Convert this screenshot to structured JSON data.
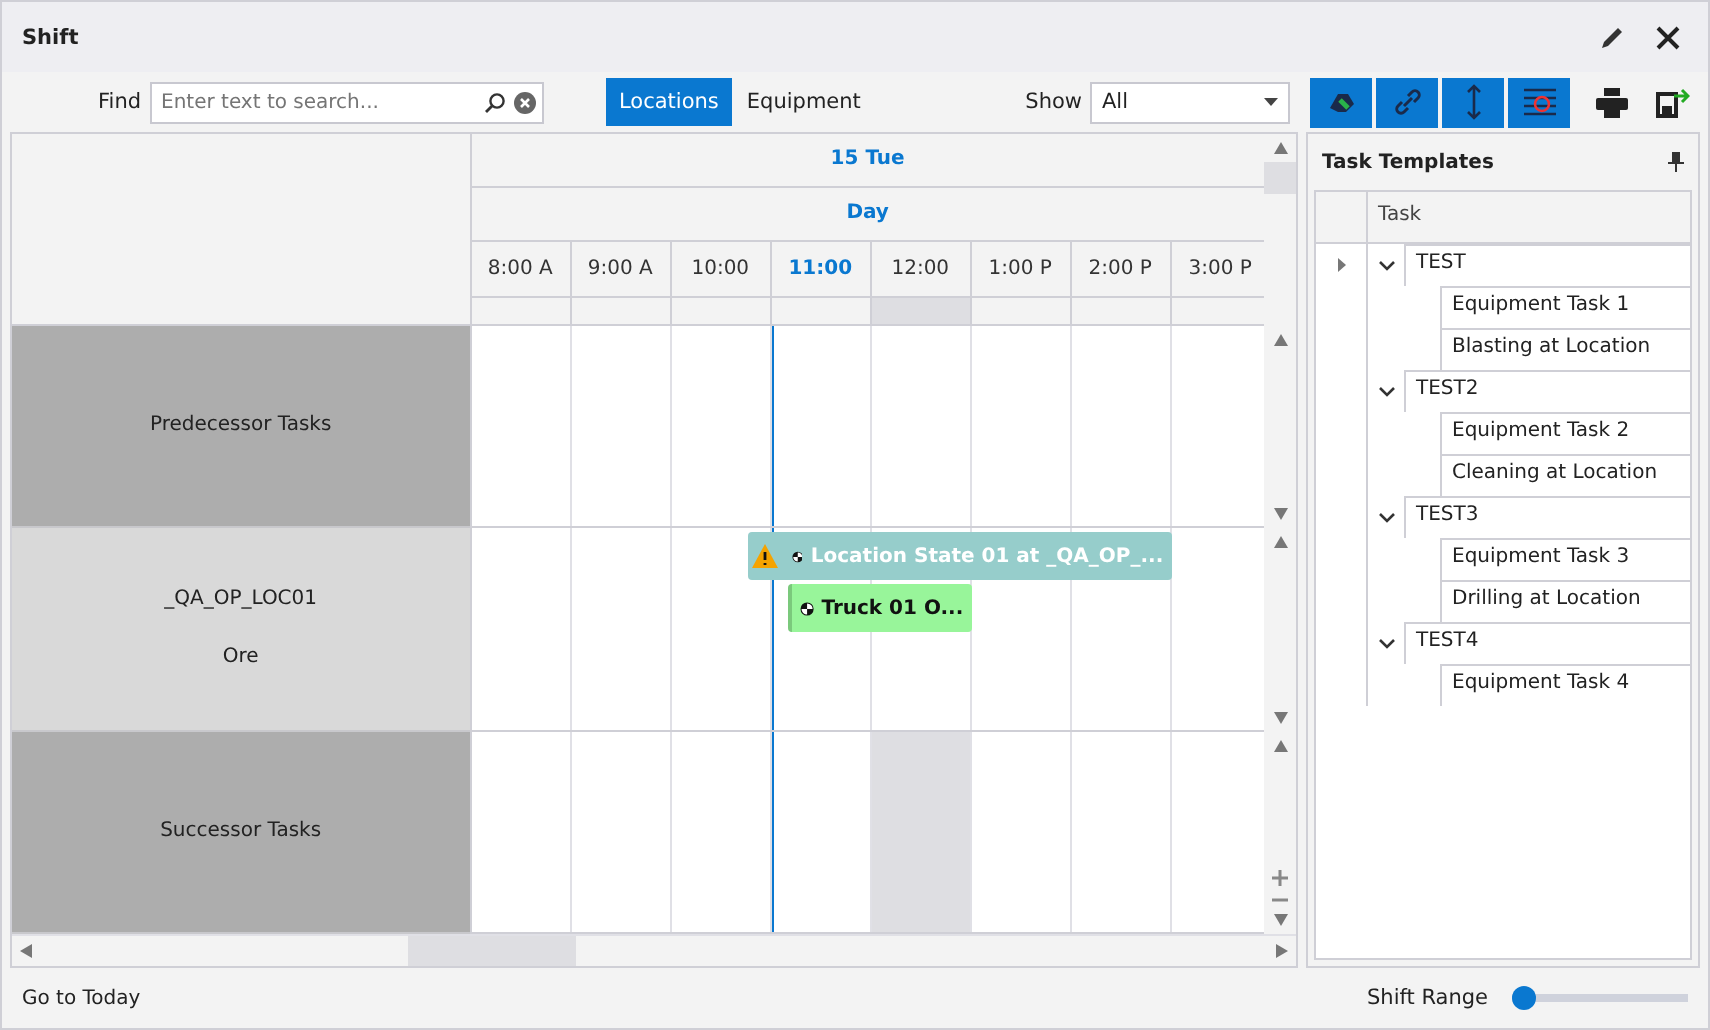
{
  "window": {
    "title": "Shift"
  },
  "find": {
    "label": "Find",
    "placeholder": "Enter text to search..."
  },
  "view_tabs": [
    {
      "label": "Locations",
      "selected": true
    },
    {
      "label": "Equipment",
      "selected": false
    }
  ],
  "show": {
    "label": "Show",
    "value": "All"
  },
  "toggles": [
    {
      "on": true
    },
    {
      "on": true
    },
    {
      "on": true
    },
    {
      "on": true
    }
  ],
  "scheduler": {
    "date": "15 Tue",
    "scale": "Day",
    "hours": [
      {
        "label": "8:00 A",
        "current": false
      },
      {
        "label": "9:00 A",
        "current": false
      },
      {
        "label": "10:00",
        "current": false
      },
      {
        "label": "11:00",
        "current": true
      },
      {
        "label": "12:00",
        "current": false
      },
      {
        "label": "1:00 P",
        "current": false
      },
      {
        "label": "2:00 P",
        "current": false
      },
      {
        "label": "3:00 P",
        "current": false
      }
    ],
    "rows": [
      {
        "kind": "group",
        "label": "Predecessor Tasks"
      },
      {
        "kind": "resource",
        "label": "_QA_OP_LOC01",
        "sublabel": "Ore",
        "events": [
          {
            "kind": "location",
            "text": "Location State 01 at _QA_OP_...",
            "warning": true
          },
          {
            "kind": "equipment",
            "text": "Truck 01 O...",
            "warning": false
          }
        ]
      },
      {
        "kind": "group",
        "label": "Successor Tasks"
      }
    ]
  },
  "task_panel": {
    "title": "Task Templates",
    "column": "Task",
    "tree": [
      {
        "label": "TEST",
        "expanded": true,
        "children": [
          {
            "label": "Equipment Task 1"
          },
          {
            "label": "Blasting at Location"
          }
        ]
      },
      {
        "label": "TEST2",
        "expanded": true,
        "children": [
          {
            "label": "Equipment Task 2"
          },
          {
            "label": "Cleaning at Location"
          }
        ]
      },
      {
        "label": "TEST3",
        "expanded": true,
        "children": [
          {
            "label": "Equipment Task 3"
          },
          {
            "label": "Drilling at Location"
          }
        ]
      },
      {
        "label": "TEST4",
        "expanded": true,
        "children": [
          {
            "label": "Equipment Task 4"
          }
        ]
      }
    ]
  },
  "footer": {
    "today": "Go to Today",
    "range_label": "Shift Range",
    "range": {
      "level": 0
    }
  }
}
